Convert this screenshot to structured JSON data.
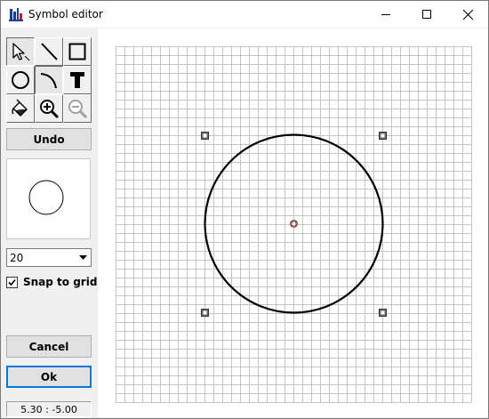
{
  "window": {
    "title": "Symbol editor"
  },
  "toolbar": {
    "tools": [
      {
        "name": "select-tool",
        "icon": "arrow-cursor-icon",
        "pressed": true
      },
      {
        "name": "line-tool",
        "icon": "line-icon",
        "pressed": false
      },
      {
        "name": "rectangle-tool",
        "icon": "rectangle-icon",
        "pressed": false
      },
      {
        "name": "circle-tool",
        "icon": "circle-icon",
        "pressed": false
      },
      {
        "name": "arc-tool",
        "icon": "arc-icon",
        "pressed": true
      },
      {
        "name": "text-tool",
        "icon": "text-t-icon",
        "pressed": false
      },
      {
        "name": "fill-tool",
        "icon": "paint-bucket-icon",
        "pressed": false
      },
      {
        "name": "zoom-in-tool",
        "icon": "zoom-in-icon",
        "pressed": false
      },
      {
        "name": "zoom-out-tool",
        "icon": "zoom-out-icon",
        "pressed": false,
        "disabled": true
      }
    ]
  },
  "controls": {
    "undo_label": "Undo",
    "grid_size": "20",
    "snap_label": "Snap to grid",
    "snap_checked": true,
    "cancel_label": "Cancel",
    "ok_label": "Ok"
  },
  "status": {
    "coordinates": "5.30 : -5.00"
  }
}
